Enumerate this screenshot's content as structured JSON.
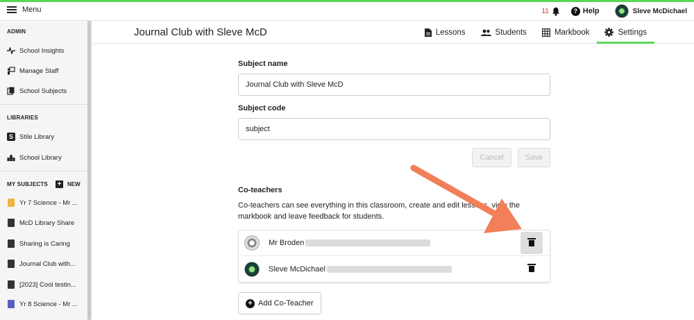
{
  "topbar": {
    "menu_label": "Menu",
    "notification_count": "11",
    "help_label": "Help",
    "user_name": "Sleve McDichael"
  },
  "sidebar": {
    "admin_heading": "ADMIN",
    "admin_items": [
      {
        "label": "School Insights",
        "icon": "activity-icon"
      },
      {
        "label": "Manage Staff",
        "icon": "staff-icon"
      },
      {
        "label": "School Subjects",
        "icon": "books-icon"
      }
    ],
    "libraries_heading": "LIBRARIES",
    "library_items": [
      {
        "label": "Stile Library",
        "icon": "stile-s-icon"
      },
      {
        "label": "School Library",
        "icon": "school-building-icon"
      }
    ],
    "my_subjects_heading": "MY SUBJECTS",
    "new_label": "NEW",
    "subject_items": [
      {
        "label": "Yr 7 Science - Mr ...",
        "color": "#f2b540"
      },
      {
        "label": "McD Library Share",
        "color": "#333333"
      },
      {
        "label": "Sharing is Caring",
        "color": "#333333"
      },
      {
        "label": "Journal Club with...",
        "color": "#333333"
      },
      {
        "label": "[2023] Cool testin...",
        "color": "#333333"
      },
      {
        "label": "Yr 8 Science - Mr ...",
        "color": "#5b5fb8"
      }
    ]
  },
  "header": {
    "title": "Journal Club with Sleve McD",
    "tabs": [
      {
        "label": "Lessons",
        "icon": "document-icon"
      },
      {
        "label": "Students",
        "icon": "people-icon"
      },
      {
        "label": "Markbook",
        "icon": "grid-icon"
      },
      {
        "label": "Settings",
        "icon": "gear-icon",
        "active": true
      }
    ]
  },
  "form": {
    "subject_name_label": "Subject name",
    "subject_name_value": "Journal Club with Sleve McD",
    "subject_code_label": "Subject code",
    "subject_code_value": "subject",
    "cancel_label": "Cancel",
    "save_label": "Save"
  },
  "coteachers": {
    "heading": "Co-teachers",
    "description": "Co-teachers can see everything in this classroom, create and edit lessons, view the markbook and leave feedback for students.",
    "list": [
      {
        "name": "Mr Broden"
      },
      {
        "name": "Sleve McDichael"
      }
    ],
    "add_label": "Add Co-Teacher"
  },
  "colors": {
    "accent_green": "#5bd65b",
    "annotation_arrow": "#f07f5a"
  }
}
